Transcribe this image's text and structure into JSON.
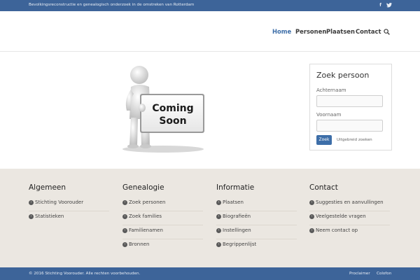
{
  "topbar": {
    "tagline": "Bevolkingsreconstructie en genealogisch onderzoek in de omstreken van Rotterdam",
    "social": {
      "facebook_icon": "facebook-icon",
      "twitter_icon": "twitter-icon"
    }
  },
  "nav": {
    "items": [
      {
        "label": "Home",
        "active": true
      },
      {
        "label": "Personen"
      },
      {
        "label": "Plaatsen"
      },
      {
        "label": "Contact"
      }
    ],
    "search_icon": "search-icon"
  },
  "hero": {
    "sign_line1": "Coming",
    "sign_line2": "Soon"
  },
  "widget": {
    "title": "Zoek persoon",
    "achternaam_label": "Achternaam",
    "achternaam_value": "",
    "voornaam_label": "Voornaam",
    "voornaam_value": "",
    "search_button": "Zoek",
    "advanced_link": "Uitgebreid zoeken"
  },
  "footer": {
    "columns": [
      {
        "title": "Algemeen",
        "items": [
          "Stichting Voorouder",
          "Statistieken"
        ]
      },
      {
        "title": "Genealogie",
        "items": [
          "Zoek personen",
          "Zoek families",
          "Familienamen",
          "Bronnen"
        ]
      },
      {
        "title": "Informatie",
        "items": [
          "Plaatsen",
          "Biografieën",
          "Instellingen",
          "Begrippenlijst"
        ]
      },
      {
        "title": "Contact",
        "items": [
          "Suggesties en aanvullingen",
          "Veelgestelde vragen",
          "Neem contact op"
        ]
      }
    ]
  },
  "bottombar": {
    "copyright": "© 2016 Stichting Voorouder. Alle rechten voorbehouden.",
    "links": [
      "Proclaimer",
      "Colofon"
    ]
  },
  "colors": {
    "brand_blue": "#3d6499",
    "accent_blue": "#3d6ea8",
    "footer_bg": "#ebe7e1"
  }
}
